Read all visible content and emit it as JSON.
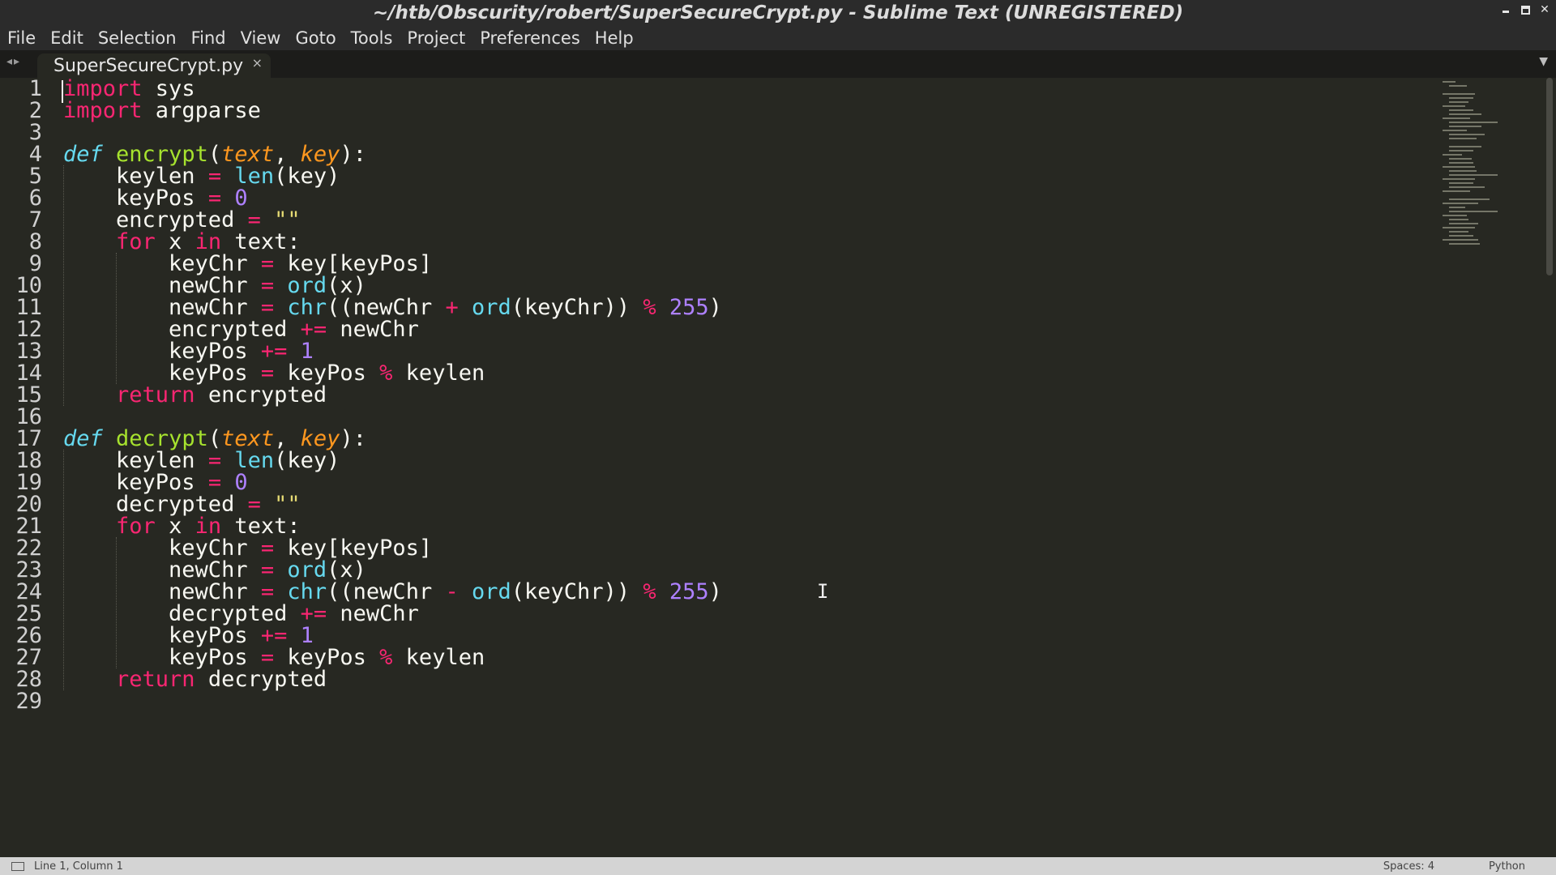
{
  "window": {
    "title": "~/htb/Obscurity/robert/SuperSecureCrypt.py - Sublime Text (UNREGISTERED)"
  },
  "menu": [
    "File",
    "Edit",
    "Selection",
    "Find",
    "View",
    "Goto",
    "Tools",
    "Project",
    "Preferences",
    "Help"
  ],
  "tab": {
    "label": "SuperSecureCrypt.py",
    "close": "×"
  },
  "icons": {
    "tab_nav": "arrow-left-right-icon",
    "tab_close": "close-icon",
    "tab_dropdown": "chevron-down-icon",
    "minimize": "minimize-icon",
    "maximize": "maximize-icon",
    "close": "close-icon"
  },
  "editor": {
    "line_numbers": [
      "1",
      "2",
      "3",
      "4",
      "5",
      "6",
      "7",
      "8",
      "9",
      "10",
      "11",
      "12",
      "13",
      "14",
      "15",
      "16",
      "17",
      "18",
      "19",
      "20",
      "21",
      "22",
      "23",
      "24",
      "25",
      "26",
      "27",
      "28",
      "29"
    ],
    "lines": [
      [
        {
          "t": "import",
          "c": "kw"
        },
        {
          "t": " sys",
          "c": ""
        }
      ],
      [
        {
          "t": "import",
          "c": "kw"
        },
        {
          "t": " argparse",
          "c": ""
        }
      ],
      [],
      [
        {
          "t": "def",
          "c": "dfn"
        },
        {
          "t": " ",
          "c": ""
        },
        {
          "t": "encrypt",
          "c": "fn"
        },
        {
          "t": "(",
          "c": ""
        },
        {
          "t": "text",
          "c": "prm"
        },
        {
          "t": ", ",
          "c": ""
        },
        {
          "t": "key",
          "c": "prm"
        },
        {
          "t": "):",
          "c": ""
        }
      ],
      [
        {
          "t": "    keylen ",
          "c": ""
        },
        {
          "t": "=",
          "c": "kw"
        },
        {
          "t": " ",
          "c": ""
        },
        {
          "t": "len",
          "c": "bi"
        },
        {
          "t": "(key)",
          "c": ""
        }
      ],
      [
        {
          "t": "    keyPos ",
          "c": ""
        },
        {
          "t": "=",
          "c": "kw"
        },
        {
          "t": " ",
          "c": ""
        },
        {
          "t": "0",
          "c": "num"
        }
      ],
      [
        {
          "t": "    encrypted ",
          "c": ""
        },
        {
          "t": "=",
          "c": "kw"
        },
        {
          "t": " ",
          "c": ""
        },
        {
          "t": "\"\"",
          "c": "str"
        }
      ],
      [
        {
          "t": "    ",
          "c": ""
        },
        {
          "t": "for",
          "c": "kw"
        },
        {
          "t": " x ",
          "c": ""
        },
        {
          "t": "in",
          "c": "kw"
        },
        {
          "t": " text:",
          "c": ""
        }
      ],
      [
        {
          "t": "        keyChr ",
          "c": ""
        },
        {
          "t": "=",
          "c": "kw"
        },
        {
          "t": " key[keyPos]",
          "c": ""
        }
      ],
      [
        {
          "t": "        newChr ",
          "c": ""
        },
        {
          "t": "=",
          "c": "kw"
        },
        {
          "t": " ",
          "c": ""
        },
        {
          "t": "ord",
          "c": "bi"
        },
        {
          "t": "(x)",
          "c": ""
        }
      ],
      [
        {
          "t": "        newChr ",
          "c": ""
        },
        {
          "t": "=",
          "c": "kw"
        },
        {
          "t": " ",
          "c": ""
        },
        {
          "t": "chr",
          "c": "bi"
        },
        {
          "t": "((newChr ",
          "c": ""
        },
        {
          "t": "+",
          "c": "kw"
        },
        {
          "t": " ",
          "c": ""
        },
        {
          "t": "ord",
          "c": "bi"
        },
        {
          "t": "(keyChr)) ",
          "c": ""
        },
        {
          "t": "%",
          "c": "kw"
        },
        {
          "t": " ",
          "c": ""
        },
        {
          "t": "255",
          "c": "num"
        },
        {
          "t": ")",
          "c": ""
        }
      ],
      [
        {
          "t": "        encrypted ",
          "c": ""
        },
        {
          "t": "+=",
          "c": "kw"
        },
        {
          "t": " newChr",
          "c": ""
        }
      ],
      [
        {
          "t": "        keyPos ",
          "c": ""
        },
        {
          "t": "+=",
          "c": "kw"
        },
        {
          "t": " ",
          "c": ""
        },
        {
          "t": "1",
          "c": "num"
        }
      ],
      [
        {
          "t": "        keyPos ",
          "c": ""
        },
        {
          "t": "=",
          "c": "kw"
        },
        {
          "t": " keyPos ",
          "c": ""
        },
        {
          "t": "%",
          "c": "kw"
        },
        {
          "t": " keylen",
          "c": ""
        }
      ],
      [
        {
          "t": "    ",
          "c": ""
        },
        {
          "t": "return",
          "c": "kw"
        },
        {
          "t": " encrypted",
          "c": ""
        }
      ],
      [],
      [
        {
          "t": "def",
          "c": "dfn"
        },
        {
          "t": " ",
          "c": ""
        },
        {
          "t": "decrypt",
          "c": "fn"
        },
        {
          "t": "(",
          "c": ""
        },
        {
          "t": "text",
          "c": "prm"
        },
        {
          "t": ", ",
          "c": ""
        },
        {
          "t": "key",
          "c": "prm"
        },
        {
          "t": "):",
          "c": ""
        }
      ],
      [
        {
          "t": "    keylen ",
          "c": ""
        },
        {
          "t": "=",
          "c": "kw"
        },
        {
          "t": " ",
          "c": ""
        },
        {
          "t": "len",
          "c": "bi"
        },
        {
          "t": "(key)",
          "c": ""
        }
      ],
      [
        {
          "t": "    keyPos ",
          "c": ""
        },
        {
          "t": "=",
          "c": "kw"
        },
        {
          "t": " ",
          "c": ""
        },
        {
          "t": "0",
          "c": "num"
        }
      ],
      [
        {
          "t": "    decrypted ",
          "c": ""
        },
        {
          "t": "=",
          "c": "kw"
        },
        {
          "t": " ",
          "c": ""
        },
        {
          "t": "\"\"",
          "c": "str"
        }
      ],
      [
        {
          "t": "    ",
          "c": ""
        },
        {
          "t": "for",
          "c": "kw"
        },
        {
          "t": " x ",
          "c": ""
        },
        {
          "t": "in",
          "c": "kw"
        },
        {
          "t": " text:",
          "c": ""
        }
      ],
      [
        {
          "t": "        keyChr ",
          "c": ""
        },
        {
          "t": "=",
          "c": "kw"
        },
        {
          "t": " key[keyPos]",
          "c": ""
        }
      ],
      [
        {
          "t": "        newChr ",
          "c": ""
        },
        {
          "t": "=",
          "c": "kw"
        },
        {
          "t": " ",
          "c": ""
        },
        {
          "t": "ord",
          "c": "bi"
        },
        {
          "t": "(x)",
          "c": ""
        }
      ],
      [
        {
          "t": "        newChr ",
          "c": ""
        },
        {
          "t": "=",
          "c": "kw"
        },
        {
          "t": " ",
          "c": ""
        },
        {
          "t": "chr",
          "c": "bi"
        },
        {
          "t": "((newChr ",
          "c": ""
        },
        {
          "t": "-",
          "c": "kw"
        },
        {
          "t": " ",
          "c": ""
        },
        {
          "t": "ord",
          "c": "bi"
        },
        {
          "t": "(keyChr)) ",
          "c": ""
        },
        {
          "t": "%",
          "c": "kw"
        },
        {
          "t": " ",
          "c": ""
        },
        {
          "t": "255",
          "c": "num"
        },
        {
          "t": ")",
          "c": ""
        }
      ],
      [
        {
          "t": "        decrypted ",
          "c": ""
        },
        {
          "t": "+=",
          "c": "kw"
        },
        {
          "t": " newChr",
          "c": ""
        }
      ],
      [
        {
          "t": "        keyPos ",
          "c": ""
        },
        {
          "t": "+=",
          "c": "kw"
        },
        {
          "t": " ",
          "c": ""
        },
        {
          "t": "1",
          "c": "num"
        }
      ],
      [
        {
          "t": "        keyPos ",
          "c": ""
        },
        {
          "t": "=",
          "c": "kw"
        },
        {
          "t": " keyPos ",
          "c": ""
        },
        {
          "t": "%",
          "c": "kw"
        },
        {
          "t": " keylen",
          "c": ""
        }
      ],
      [
        {
          "t": "    ",
          "c": ""
        },
        {
          "t": "return",
          "c": "kw"
        },
        {
          "t": " decrypted",
          "c": ""
        }
      ],
      []
    ]
  },
  "status": {
    "position": "Line 1, Column 1",
    "spaces": "Spaces: 4",
    "syntax": "Python"
  },
  "colors": {
    "background": "#272822",
    "keyword": "#f92672",
    "function": "#a6e22e",
    "builtin": "#66d9ef",
    "number": "#ae81ff",
    "string": "#e6db74",
    "parameter": "#fd971f"
  }
}
